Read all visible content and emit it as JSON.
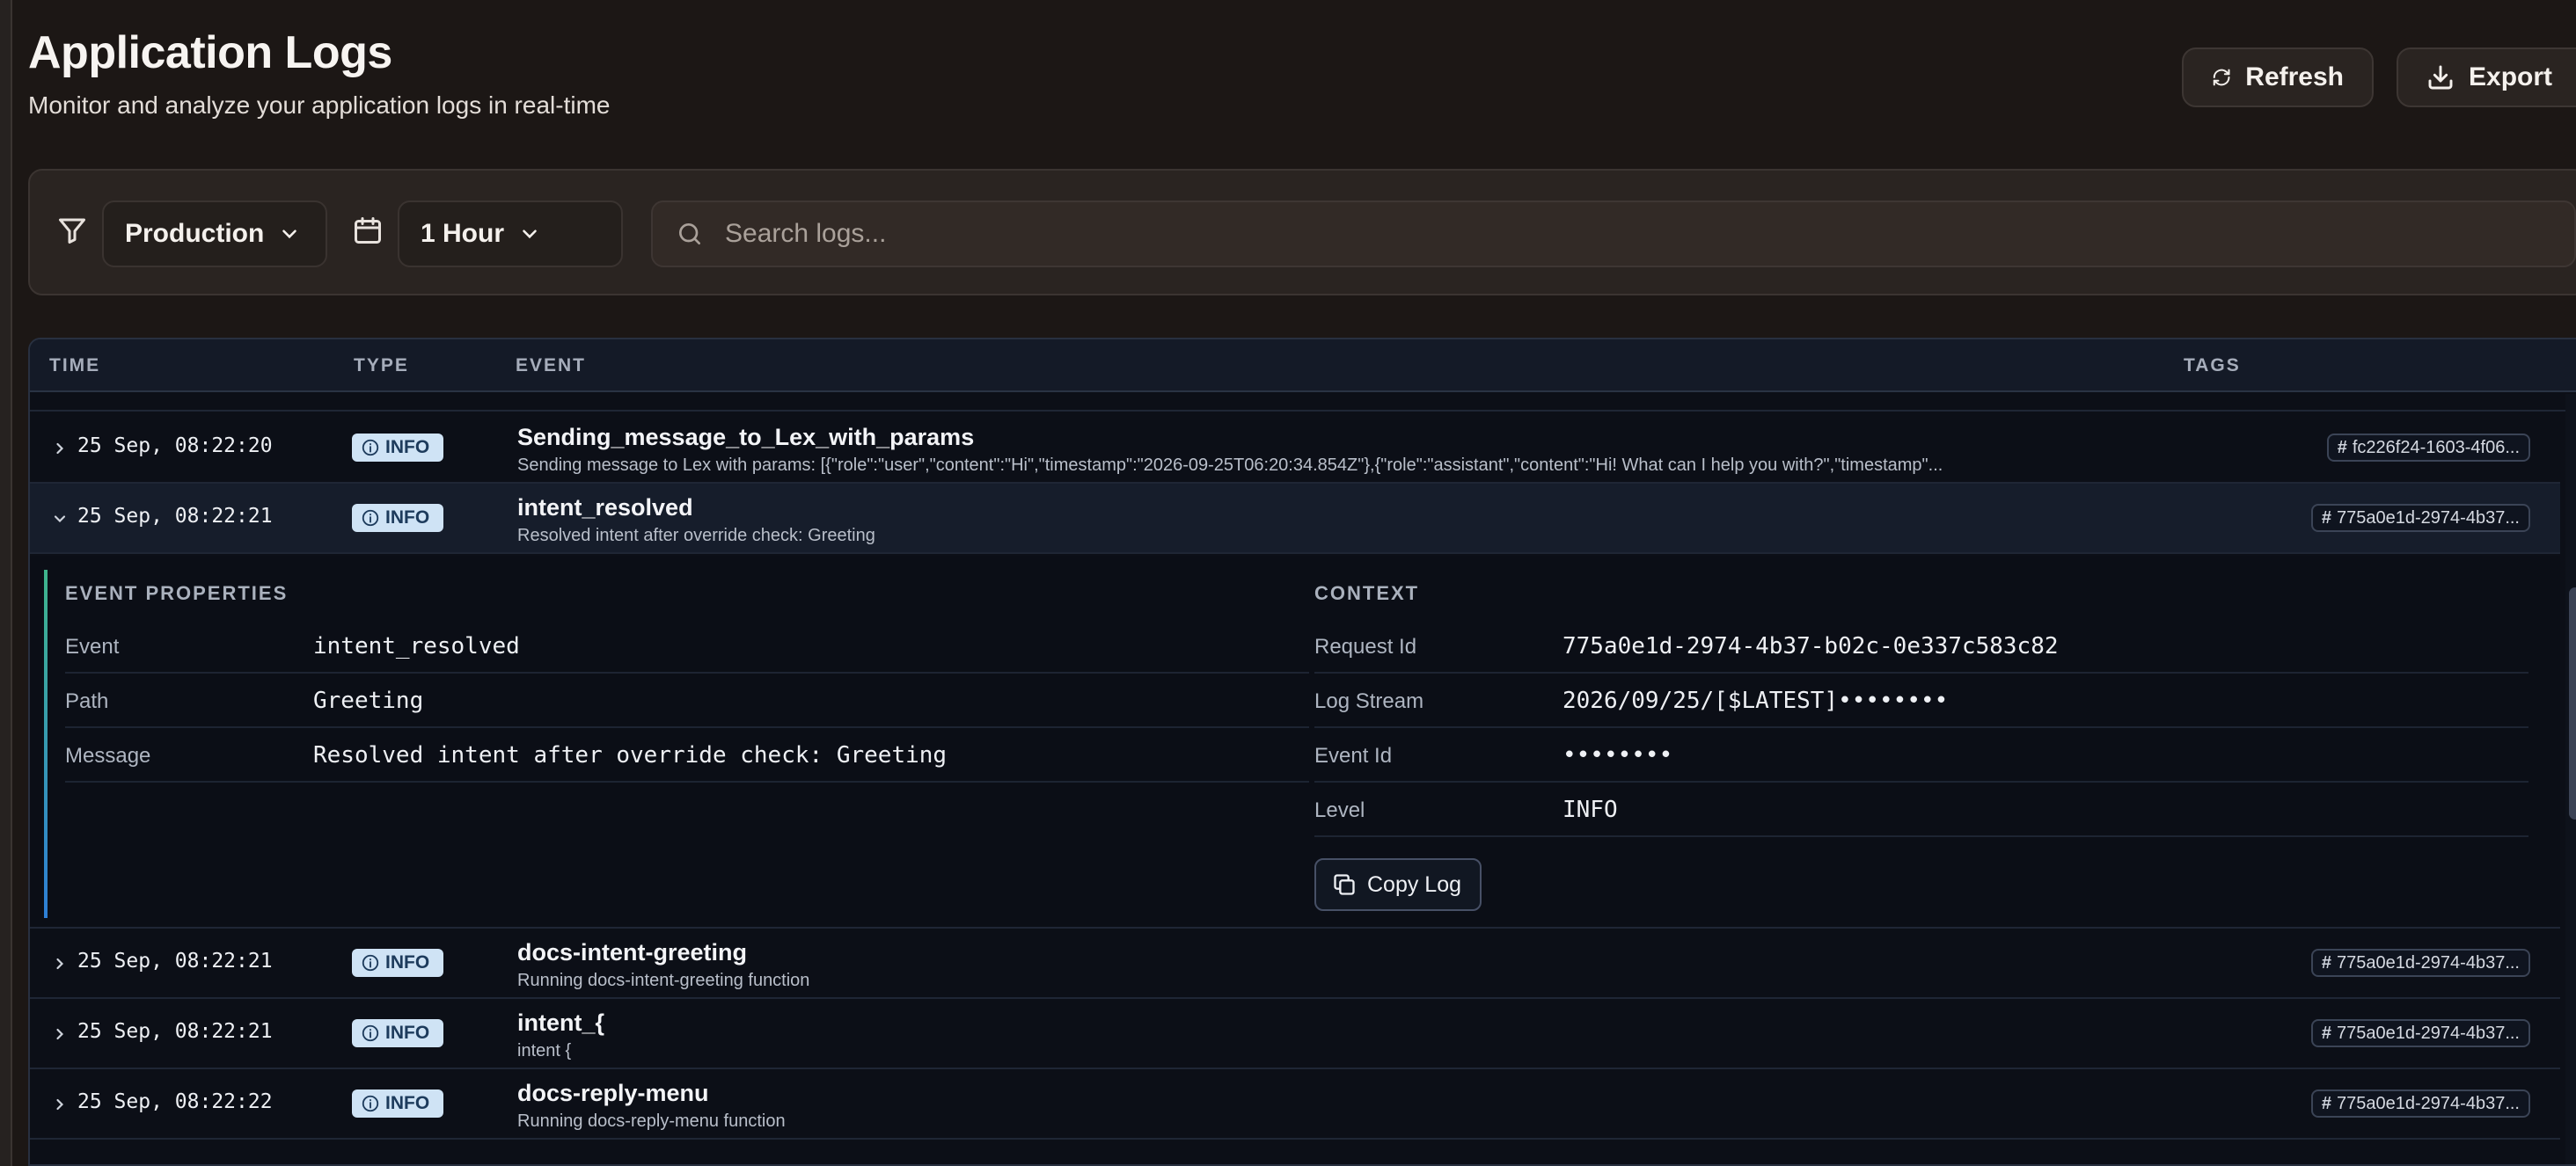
{
  "header": {
    "title": "Application Logs",
    "subtitle": "Monitor and analyze your application logs in real-time",
    "refresh_label": "Refresh",
    "export_label": "Export"
  },
  "filters": {
    "environment": "Production",
    "time_range": "1 Hour",
    "search_placeholder": "Search logs..."
  },
  "table": {
    "columns": {
      "time": "TIME",
      "type": "TYPE",
      "event": "EVENT",
      "tags": "TAGS"
    },
    "rows": [
      {
        "time": "25 Sep, 08:22:20",
        "type": "INFO",
        "event": "Sending_message_to_Lex_with_params",
        "desc": "Sending message to Lex with params: [{\"role\":\"user\",\"content\":\"Hi\",\"timestamp\":\"2026-09-25T06:20:34.854Z\"},{\"role\":\"assistant\",\"content\":\"Hi! What can I help you with?\",\"timestamp\"...",
        "tag": "fc226f24-1603-4f06..."
      },
      {
        "time": "25 Sep, 08:22:21",
        "type": "INFO",
        "event": "intent_resolved",
        "desc": "Resolved intent after override check: Greeting",
        "tag": "775a0e1d-2974-4b37..."
      },
      {
        "time": "25 Sep, 08:22:21",
        "type": "INFO",
        "event": "docs-intent-greeting",
        "desc": "Running docs-intent-greeting function",
        "tag": "775a0e1d-2974-4b37..."
      },
      {
        "time": "25 Sep, 08:22:21",
        "type": "INFO",
        "event": "intent_{",
        "desc": "intent {",
        "tag": "775a0e1d-2974-4b37..."
      },
      {
        "time": "25 Sep, 08:22:22",
        "type": "INFO",
        "event": "docs-reply-menu",
        "desc": "Running docs-reply-menu function",
        "tag": "775a0e1d-2974-4b37..."
      }
    ]
  },
  "detail": {
    "properties_title": "EVENT PROPERTIES",
    "properties": [
      {
        "key": "Event",
        "value": "intent_resolved"
      },
      {
        "key": "Path",
        "value": "Greeting"
      },
      {
        "key": "Message",
        "value": "Resolved intent after override check: Greeting"
      }
    ],
    "context_title": "CONTEXT",
    "context": [
      {
        "key": "Request Id",
        "value": "775a0e1d-2974-4b37-b02c-0e337c583c82"
      },
      {
        "key": "Log Stream",
        "value": "2026/09/25/[$LATEST]••••••••"
      },
      {
        "key": "Event Id",
        "value": "••••••••"
      },
      {
        "key": "Level",
        "value": "INFO"
      }
    ],
    "copy_label": "Copy Log"
  },
  "colors": {
    "background": "#1c1715",
    "table_bg": "#0c0f17",
    "info_badge": "#cfe3f5",
    "accent_green": "#3fb58c",
    "accent_blue": "#2e7fd6"
  },
  "icons": [
    "refresh-icon",
    "download-icon",
    "filter-icon",
    "calendar-icon",
    "search-icon",
    "chevron-down-icon",
    "chevron-right-icon",
    "info-circle-icon",
    "hash-icon",
    "copy-icon"
  ]
}
